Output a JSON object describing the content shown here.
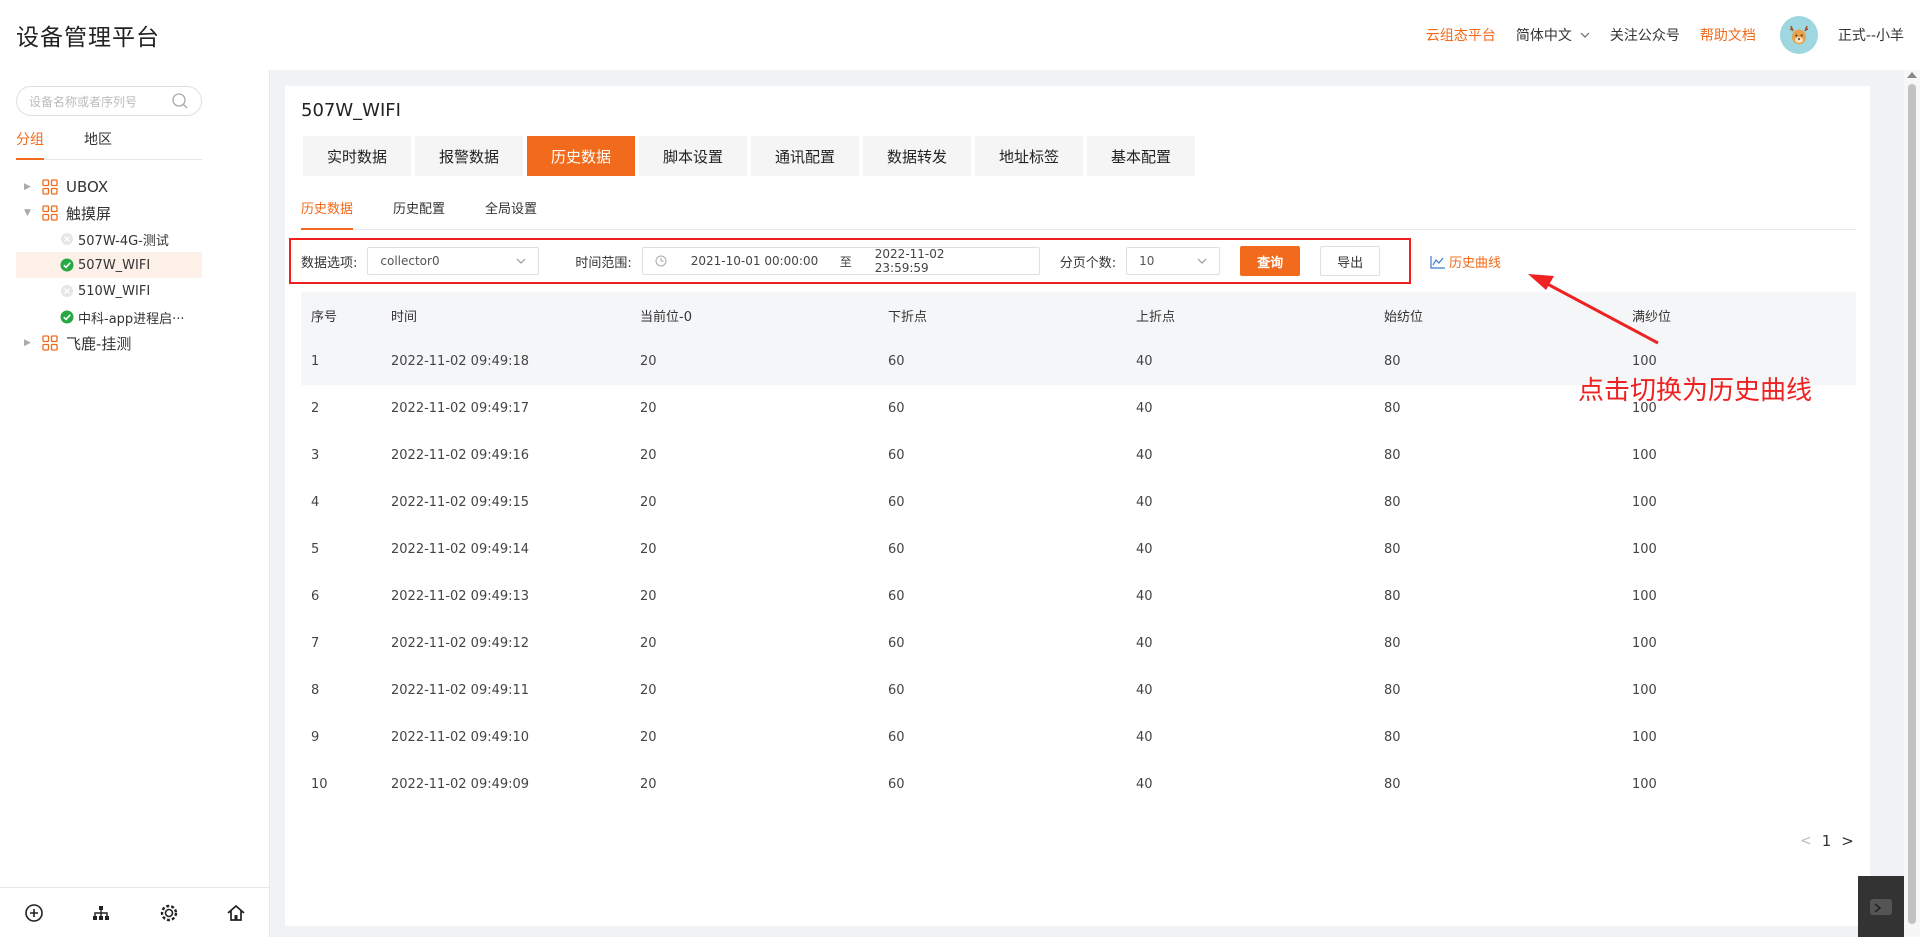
{
  "brand": "设备管理平台",
  "header": {
    "cloud_platform": "云组态平台",
    "language": "简体中文",
    "follow": "关注公众号",
    "help": "帮助文档",
    "username": "正式--小羊"
  },
  "sidebar": {
    "search_placeholder": "设备名称或者序列号",
    "tabs": [
      "分组",
      "地区"
    ],
    "tree": [
      {
        "label": "UBOX",
        "level": 0,
        "expanded": false
      },
      {
        "label": "触摸屏",
        "level": 0,
        "expanded": true
      },
      {
        "label": "507W-4G-测试",
        "level": 1,
        "status": "offline"
      },
      {
        "label": "507W_WIFI",
        "level": 1,
        "status": "online",
        "selected": true
      },
      {
        "label": "510W_WIFI",
        "level": 1,
        "status": "offline"
      },
      {
        "label": "中科-app进程启···",
        "level": 1,
        "status": "online"
      },
      {
        "label": "飞鹿-挂测",
        "level": 0,
        "expanded": false
      }
    ]
  },
  "device_title": "507W_WIFI",
  "tabs": [
    "实时数据",
    "报警数据",
    "历史数据",
    "脚本设置",
    "通讯配置",
    "数据转发",
    "地址标签",
    "基本配置"
  ],
  "active_tab": 2,
  "subtabs": [
    "历史数据",
    "历史配置",
    "全局设置"
  ],
  "filter": {
    "data_option_label": "数据选项:",
    "data_option_value": "collector0",
    "time_range_label": "时间范围:",
    "start_time": "2021-10-01 00:00:00",
    "range_sep": "至",
    "end_time": "2022-11-02 23:59:59",
    "page_size_label": "分页个数:",
    "page_size_value": "10",
    "query_button": "查询",
    "export_button": "导出",
    "curve_link": "历史曲线"
  },
  "table": {
    "columns": [
      "序号",
      "时间",
      "当前位-0",
      "下折点",
      "上折点",
      "始纺位",
      "满纱位"
    ],
    "rows": [
      [
        "1",
        "2022-11-02 09:49:18",
        "20",
        "60",
        "40",
        "80",
        "100"
      ],
      [
        "2",
        "2022-11-02 09:49:17",
        "20",
        "60",
        "40",
        "80",
        "100"
      ],
      [
        "3",
        "2022-11-02 09:49:16",
        "20",
        "60",
        "40",
        "80",
        "100"
      ],
      [
        "4",
        "2022-11-02 09:49:15",
        "20",
        "60",
        "40",
        "80",
        "100"
      ],
      [
        "5",
        "2022-11-02 09:49:14",
        "20",
        "60",
        "40",
        "80",
        "100"
      ],
      [
        "6",
        "2022-11-02 09:49:13",
        "20",
        "60",
        "40",
        "80",
        "100"
      ],
      [
        "7",
        "2022-11-02 09:49:12",
        "20",
        "60",
        "40",
        "80",
        "100"
      ],
      [
        "8",
        "2022-11-02 09:49:11",
        "20",
        "60",
        "40",
        "80",
        "100"
      ],
      [
        "9",
        "2022-11-02 09:49:10",
        "20",
        "60",
        "40",
        "80",
        "100"
      ],
      [
        "10",
        "2022-11-02 09:49:09",
        "20",
        "60",
        "40",
        "80",
        "100"
      ]
    ]
  },
  "pagination": {
    "current": "1"
  },
  "annotation": "点击切换为历史曲线",
  "colors": {
    "accent": "#f26a1b",
    "annotation": "#ee2222",
    "online": "#27a845"
  }
}
